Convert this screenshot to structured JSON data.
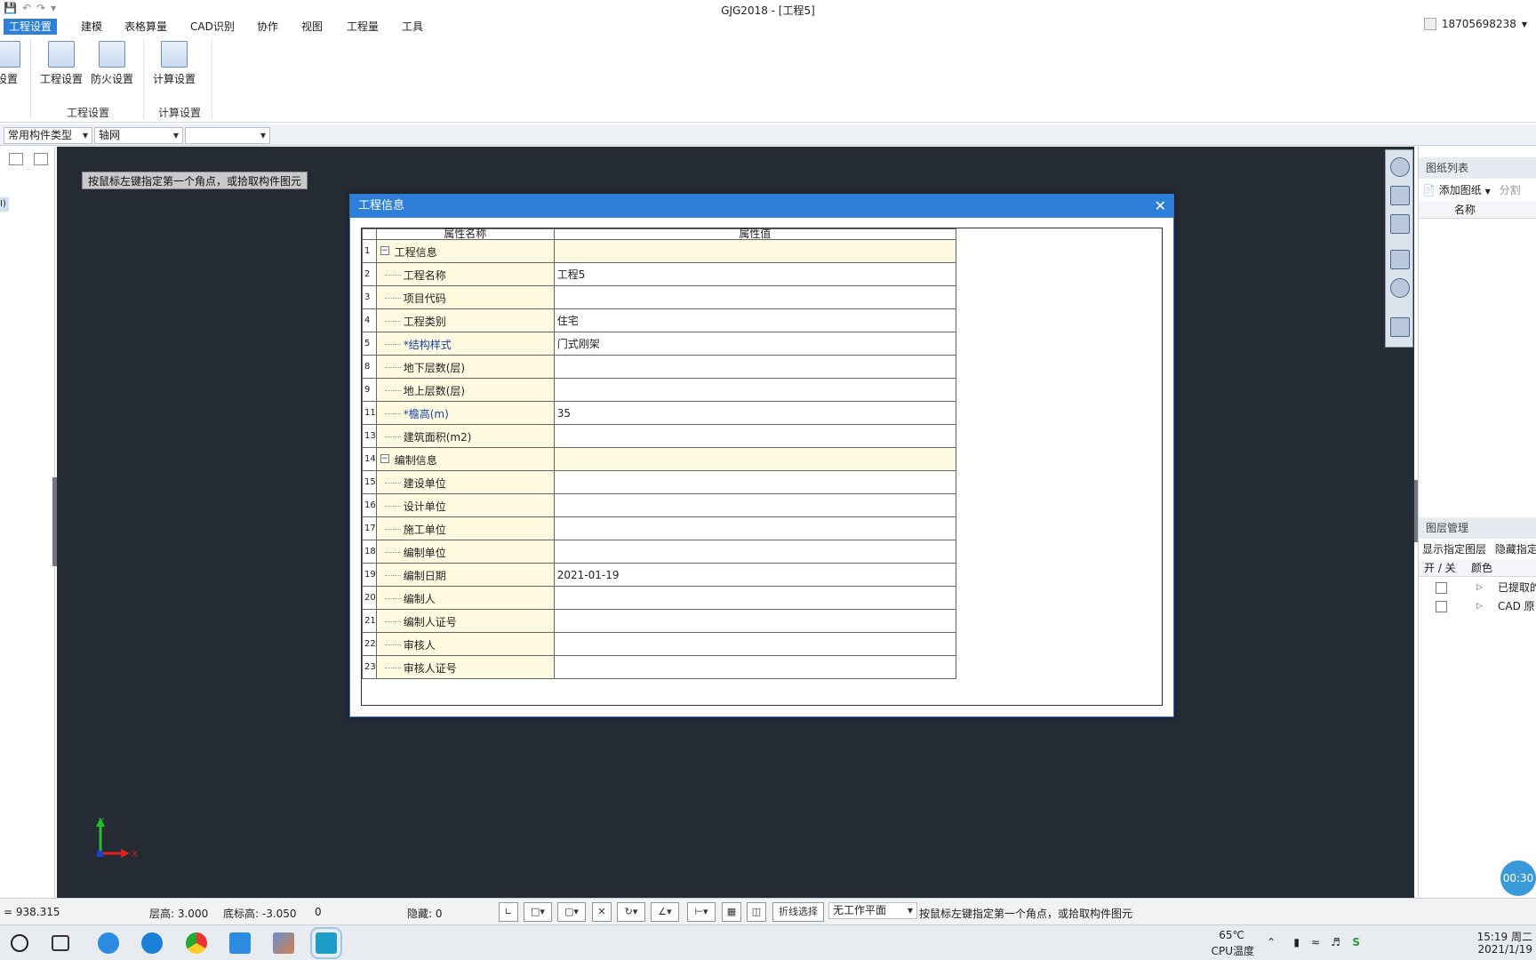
{
  "window": {
    "title": "GJG2018 - [工程5]"
  },
  "menu": {
    "tabs": [
      "工程设置",
      "建模",
      "表格算量",
      "CAD识别",
      "协作",
      "视图",
      "工程量",
      "工具"
    ],
    "active": "工程设置"
  },
  "user": {
    "name": "18705698238"
  },
  "ribbon": {
    "partial_button": "设置",
    "buttons": [
      {
        "label": "工程设置",
        "icon": "project-settings-icon"
      },
      {
        "label": "防火设置",
        "icon": "fire-settings-icon"
      },
      {
        "label": "计算设置",
        "icon": "calc-settings-icon"
      }
    ],
    "groups": [
      "工程设置",
      "计算设置"
    ]
  },
  "toolbar": {
    "combo1": "常用构件类型",
    "combo2": "轴网",
    "combo3": ""
  },
  "left_panel": {
    "selected_fragment": "I)"
  },
  "canvas": {
    "hint": "按鼠标左键指定第一个角点，或拾取构件图元"
  },
  "right_panel": {
    "drawing_list": {
      "title": "图纸列表",
      "add_label": "添加图纸",
      "split_label": "分割",
      "col_name": "名称"
    },
    "layer_mgmt": {
      "title": "图层管理",
      "show_label": "显示指定图层",
      "hide_label": "隐藏指定",
      "col_onoff": "开 / 关",
      "col_color": "颜色",
      "rows": [
        "已提取的",
        "CAD 原"
      ]
    }
  },
  "dialog": {
    "title": "工程信息",
    "col_name": "属性名称",
    "col_value": "属性值",
    "rows": [
      {
        "num": "1",
        "name": "工程信息",
        "value": "",
        "group": true
      },
      {
        "num": "2",
        "name": "工程名称",
        "value": "工程5"
      },
      {
        "num": "3",
        "name": "项目代码",
        "value": ""
      },
      {
        "num": "4",
        "name": "工程类别",
        "value": "住宅"
      },
      {
        "num": "5",
        "name": "*结构样式",
        "value": "门式刚架",
        "blue": true
      },
      {
        "num": "8",
        "name": "地下层数(层)",
        "value": ""
      },
      {
        "num": "9",
        "name": "地上层数(层)",
        "value": ""
      },
      {
        "num": "11",
        "name": "*檐高(m)",
        "value": "35",
        "blue": true
      },
      {
        "num": "13",
        "name": "建筑面积(m2)",
        "value": ""
      },
      {
        "num": "14",
        "name": "编制信息",
        "value": "",
        "group": true
      },
      {
        "num": "15",
        "name": "建设单位",
        "value": ""
      },
      {
        "num": "16",
        "name": "设计单位",
        "value": ""
      },
      {
        "num": "17",
        "name": "施工单位",
        "value": ""
      },
      {
        "num": "18",
        "name": "编制单位",
        "value": ""
      },
      {
        "num": "19",
        "name": "编制日期",
        "value": "2021-01-19"
      },
      {
        "num": "20",
        "name": "编制人",
        "value": ""
      },
      {
        "num": "21",
        "name": "编制人证号",
        "value": ""
      },
      {
        "num": "22",
        "name": "审核人",
        "value": ""
      },
      {
        "num": "23",
        "name": "审核人证号",
        "value": ""
      }
    ]
  },
  "axis": {
    "y": "Y",
    "x": "X"
  },
  "timer": "00:30",
  "status": {
    "coord": "= 938.315",
    "floor_height": "层高: 3.000",
    "base_height": "底标高: -3.050",
    "zero": "0",
    "hidden": "隐藏: 0",
    "polyline_select": "折线选择",
    "workplane": "无工作平面",
    "hint": "按鼠标左键指定第一个角点，或拾取构件图元"
  },
  "tray": {
    "temp": "65℃",
    "temp_label": "CPU温度",
    "time": "15:19 周二",
    "date": "2021/1/19"
  },
  "colors": {
    "accent": "#2e7fd8",
    "canvas": "#252b35",
    "name_cell": "#fffbe0"
  }
}
